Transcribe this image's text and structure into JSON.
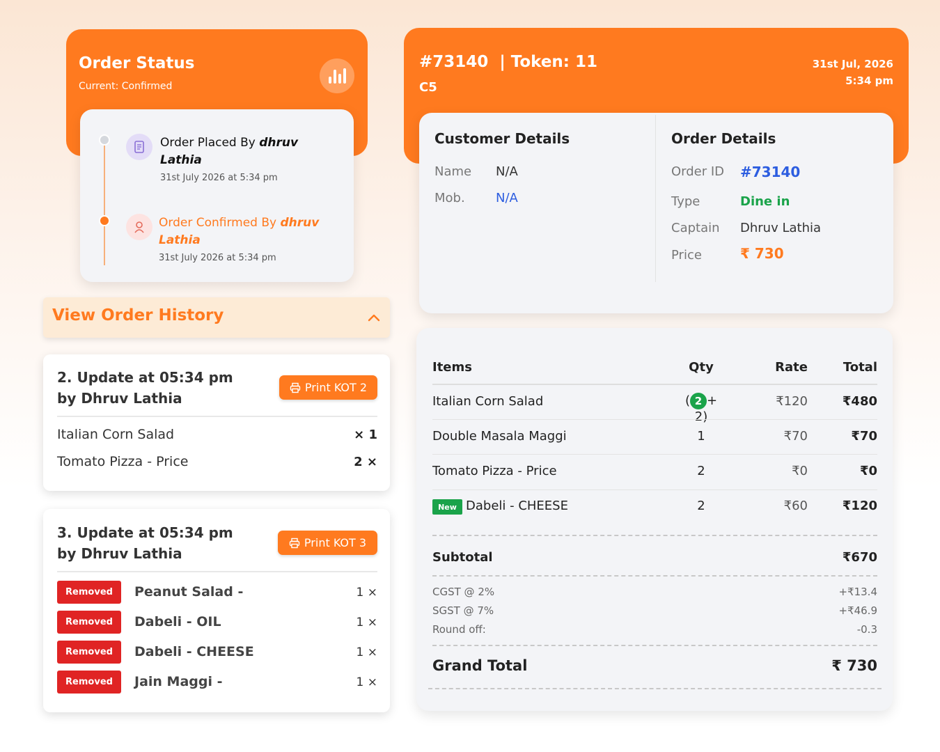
{
  "status": {
    "title": "Order Status",
    "current": "Current: Confirmed",
    "icon": "bar-chart-icon",
    "timeline": [
      {
        "prefix": "Order Placed By ",
        "user": "dhruv Lathia",
        "date": "31st July 2026 at 5:34 pm",
        "icon": "receipt-icon"
      },
      {
        "prefix": "Order Confirmed By ",
        "user": "dhruv Lathia",
        "date": "31st July 2026 at 5:34 pm",
        "icon": "chef-icon"
      }
    ]
  },
  "history": {
    "label": "View Order History",
    "icon": "chevron-up-icon",
    "updates": [
      {
        "title": "2. Update at 05:34 pm",
        "by": "by Dhruv Lathia",
        "kot_label": "Print KOT 2",
        "items": [
          {
            "name": "Italian Corn Salad",
            "qty": "× 1"
          },
          {
            "name": "Tomato Pizza - Price",
            "qty": "2 ×"
          }
        ]
      },
      {
        "title": "3. Update at 05:34 pm",
        "by": "by Dhruv Lathia",
        "kot_label": "Print KOT 3",
        "removed_label": "Removed",
        "items": [
          {
            "name": "Peanut Salad -",
            "qty": "1 ×"
          },
          {
            "name": "Dabeli - OIL",
            "qty": "1 ×"
          },
          {
            "name": "Dabeli - CHEESE",
            "qty": "1 ×"
          },
          {
            "name": "Jain Maggi -",
            "qty": "1 ×"
          }
        ]
      }
    ]
  },
  "order": {
    "id_title": "#73140",
    "token": "| Token: 11",
    "table": "C5",
    "date": "31st Jul, 2026",
    "time": "5:34 pm"
  },
  "customer": {
    "title": "Customer Details",
    "name_label": "Name",
    "name_value": "N/A",
    "mob_label": "Mob.",
    "mob_value": "N/A"
  },
  "order_details": {
    "title": "Order Details",
    "id_label": "Order ID",
    "id_value": "#73140",
    "type_label": "Type",
    "type_value": "Dine in",
    "captain_label": "Captain",
    "captain_value": "Dhruv Lathia",
    "price_label": "Price",
    "price_value": "₹ 730",
    "colors": {
      "id": "#2c5de0",
      "type": "#1aa34a",
      "price": "#ff7a1f"
    }
  },
  "bill": {
    "headers": {
      "items": "Items",
      "qty": "Qty",
      "rate": "Rate",
      "total": "Total"
    },
    "rows": [
      {
        "name": "Italian Corn Salad",
        "qty_open": "(",
        "qty_badge": "2",
        "qty_rest": "+ 2)",
        "rate": "₹120",
        "total": "₹480"
      },
      {
        "name": "Double Masala Maggi",
        "qty": "1",
        "rate": "₹70",
        "total": "₹70"
      },
      {
        "name": "Tomato Pizza - Price",
        "qty": "2",
        "rate": "₹0",
        "total": "₹0"
      },
      {
        "name": "Dabeli - CHEESE",
        "badge": "New",
        "qty": "2",
        "rate": "₹60",
        "total": "₹120"
      }
    ],
    "subtotal_label": "Subtotal",
    "subtotal_value": "₹670",
    "taxes": [
      {
        "label": "CGST @ 2%",
        "value": "+₹13.4"
      },
      {
        "label": "SGST @ 7%",
        "value": "+₹46.9"
      },
      {
        "label": "Round off:",
        "value": "-0.3"
      }
    ],
    "grand_total_label": "Grand Total",
    "grand_total_value": "₹ 730"
  },
  "colors": {
    "accent": "#ff7a1f",
    "removed": "#e02424",
    "new": "#1aa34a"
  }
}
